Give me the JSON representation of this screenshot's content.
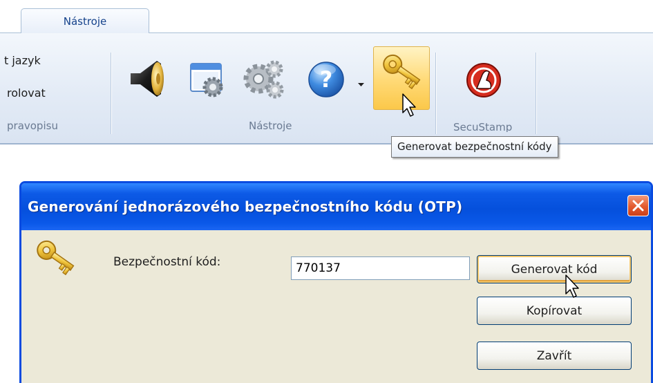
{
  "ribbon": {
    "tab_label": "Nástroje",
    "left_group": {
      "item1": "t jazyk",
      "item2": "rolovat",
      "group_label": "pravopisu"
    },
    "tools_group_label": "Nástroje",
    "secustamp_group_label": "SecuStamp",
    "icons": [
      "speaker-icon",
      "window-settings-icon",
      "gears-icon",
      "help-icon",
      "dropdown-arrow-icon",
      "key-icon",
      "secustamp-icon"
    ],
    "tooltip": "Generovat bezpečnostní kódy"
  },
  "dialog": {
    "title": "Generování jednorázového bezpečnostního kódu (OTP)",
    "label": "Bezpečnostní kód:",
    "code_value": "770137",
    "buttons": {
      "generate": "Generovat kód",
      "copy": "Kopírovat",
      "close": "Zavřít"
    }
  }
}
